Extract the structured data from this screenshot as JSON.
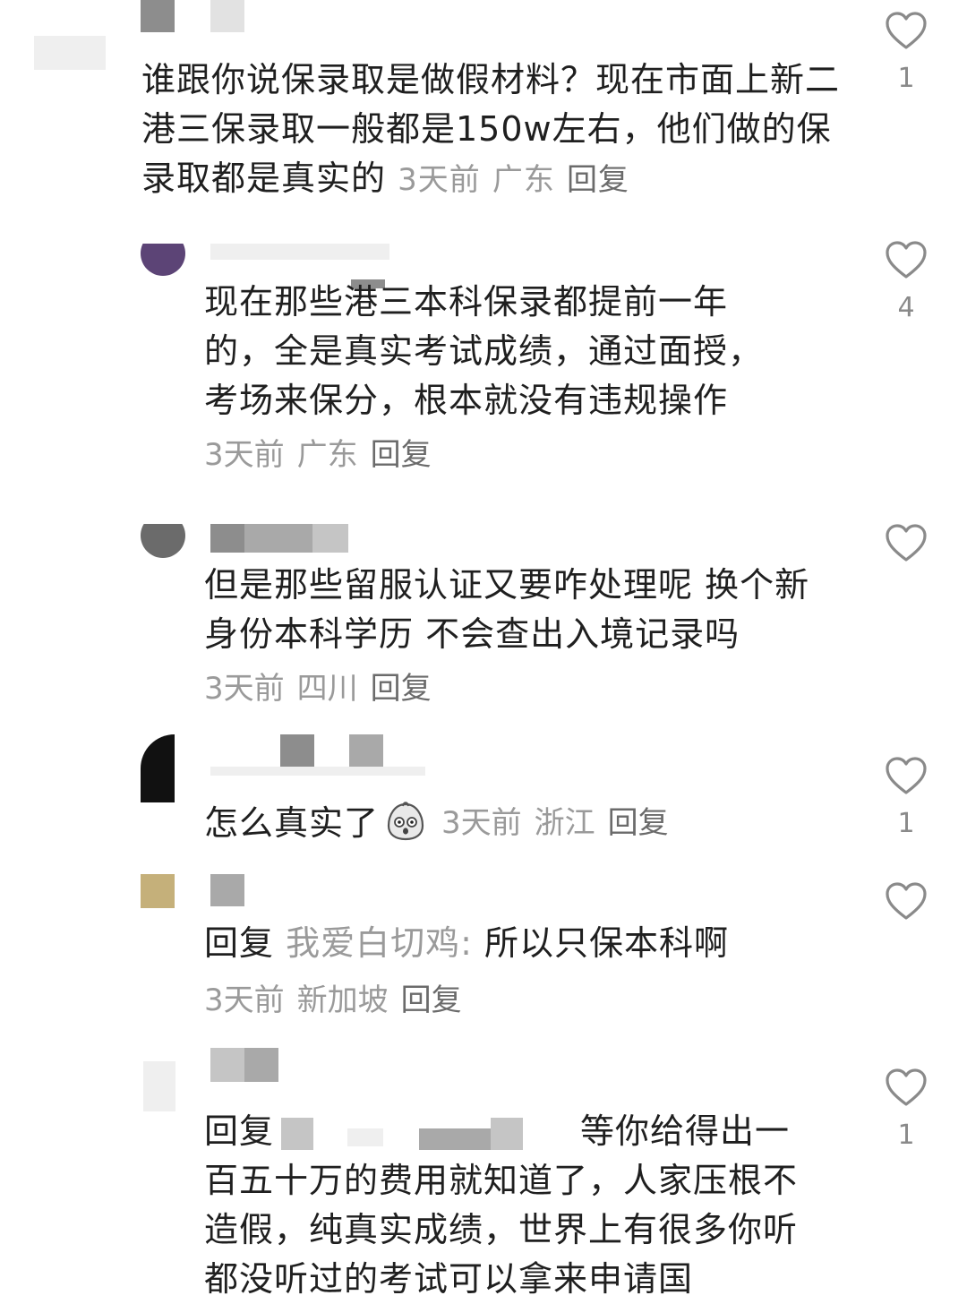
{
  "comments": [
    {
      "text": "谁跟你说保录取是做假材料？现在市面上新二港三保录取一般都是150w左右，他们做的保录取都是真实的",
      "time": "3天前",
      "location": "广东",
      "reply_label": "回复",
      "likes": "1"
    },
    {
      "text": "现在那些港三本科保录都提前一年的，全是真实考试成绩，通过面授，考场来保分，根本就没有违规操作",
      "time": "3天前",
      "location": "广东",
      "reply_label": "回复",
      "likes": "4"
    },
    {
      "text": "但是那些留服认证又要咋处理呢 换个新身份本科学历 不会查出入境记录吗",
      "time": "3天前",
      "location": "四川",
      "reply_label": "回复",
      "likes": ""
    },
    {
      "text": "怎么真实了",
      "time": "3天前",
      "location": "浙江",
      "reply_label": "回复",
      "likes": "1"
    },
    {
      "reply_prefix": "回复",
      "reply_to": "我爱白切鸡",
      "text": "所以只保本科啊",
      "time": "3天前",
      "location": "新加坡",
      "reply_label": "回复",
      "likes": ""
    },
    {
      "reply_prefix": "回复",
      "text_first": "等你给得出一",
      "text_rest": "百五十万的费用就知道了，人家压根不造假，纯真实成绩，世界上有很多你听都没听过的考试可以拿来申请国",
      "likes": "1"
    }
  ],
  "icons": {
    "like": "heart-outline-icon",
    "emoji": "surprised-emoji-icon"
  },
  "colors": {
    "text": "#1f1f1f",
    "meta": "#9a9a9a",
    "icon": "#8a8a8a"
  }
}
